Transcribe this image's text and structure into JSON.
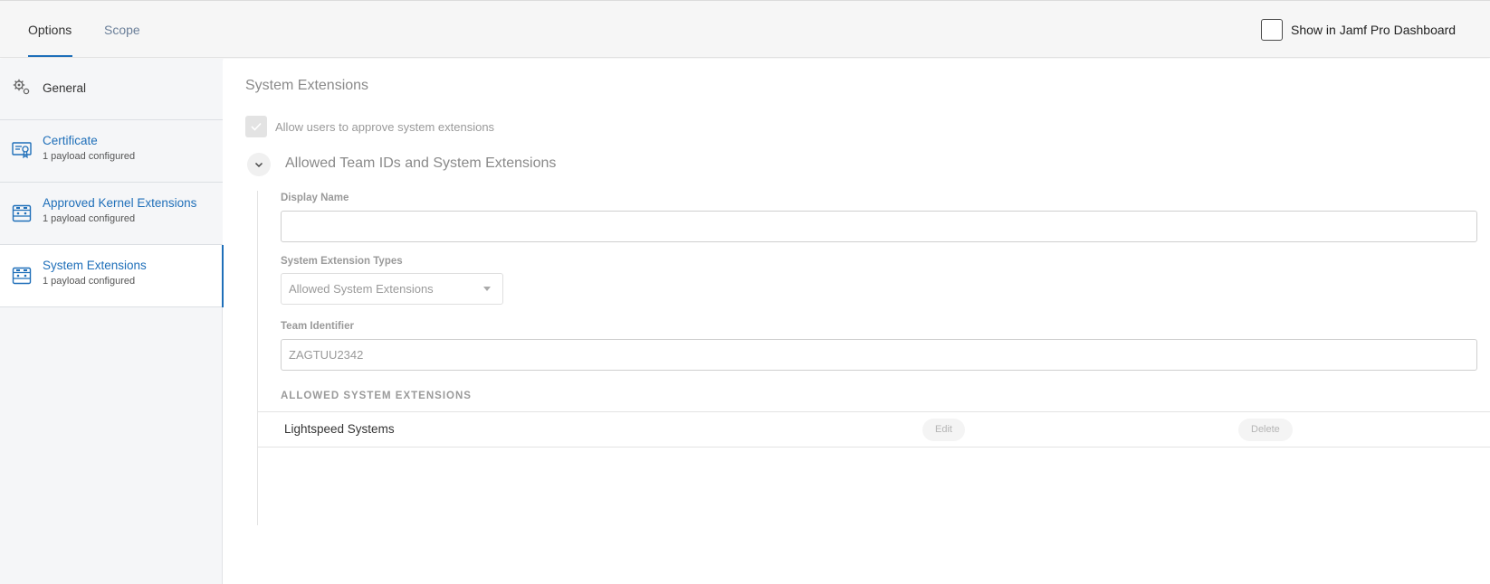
{
  "header": {
    "tabs": [
      {
        "label": "Options",
        "active": true
      },
      {
        "label": "Scope",
        "active": false
      }
    ],
    "dashboard_toggle": {
      "label": "Show in Jamf Pro Dashboard",
      "checked": false
    }
  },
  "sidebar": {
    "items": [
      {
        "title": "General",
        "subtitle": "",
        "icon": "gear-icon"
      },
      {
        "title": "Certificate",
        "subtitle": "1 payload configured",
        "icon": "certificate-icon"
      },
      {
        "title": "Approved Kernel Extensions",
        "subtitle": "1 payload configured",
        "icon": "extension-icon"
      },
      {
        "title": "System Extensions",
        "subtitle": "1 payload configured",
        "icon": "extension-icon",
        "selected": true
      }
    ]
  },
  "main": {
    "title": "System Extensions",
    "allow_checkbox": {
      "label": "Allow users to approve system extensions",
      "checked": true,
      "disabled": true
    },
    "section": {
      "title": "Allowed Team IDs and System Extensions",
      "expanded": true,
      "display_name": {
        "label": "Display Name",
        "value": ""
      },
      "types": {
        "label": "System Extension Types",
        "selected": "Allowed System Extensions"
      },
      "team_id": {
        "label": "Team Identifier",
        "value": "ZAGTUU2342"
      },
      "list": {
        "heading": "ALLOWED SYSTEM EXTENSIONS",
        "rows": [
          {
            "name": "Lightspeed Systems",
            "edit_label": "Edit",
            "delete_label": "Delete"
          }
        ]
      }
    }
  },
  "colors": {
    "accent": "#1f6fb9",
    "muted_text": "#9a9a9a",
    "sidebar_bg": "#f5f6f8"
  }
}
